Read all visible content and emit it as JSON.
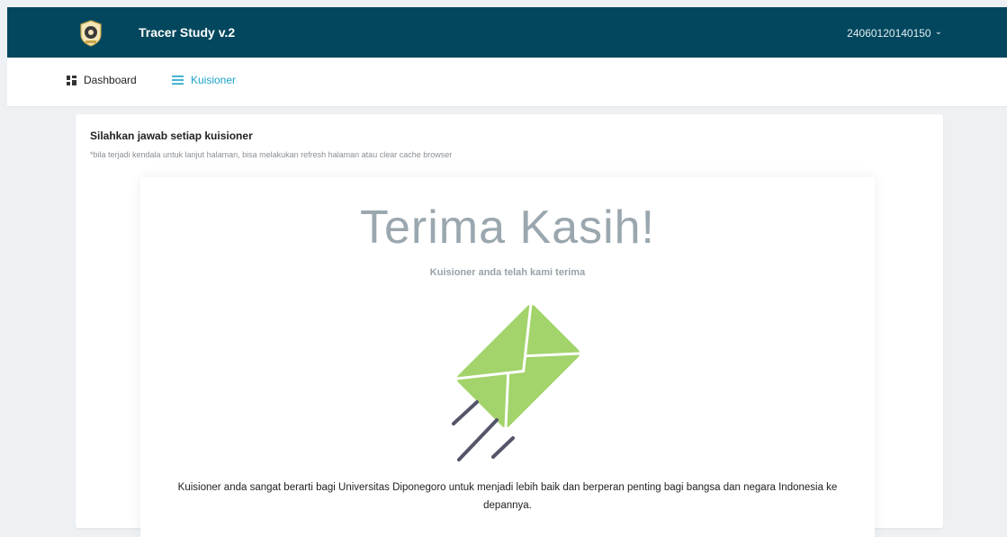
{
  "header": {
    "app_title": "Tracer Study v.2",
    "user_id": "24060120140150",
    "user_chevron": "⌄"
  },
  "nav": {
    "dashboard_label": "Dashboard",
    "kuisioner_label": "Kuisioner"
  },
  "card": {
    "title": "Silahkan jawab setiap kuisioner",
    "note": "*bila terjadi kendala untuk lanjut halaman, bisa melakukan refresh halaman atau clear cache browser"
  },
  "result": {
    "heading": "Terima Kasih!",
    "subheading": "Kuisioner anda telah kami terima",
    "message": "Kuisioner anda sangat berarti bagi Universitas Diponegoro untuk menjadi lebih baik dan berperan penting bagi bangsa dan negara Indonesia ke depannya."
  },
  "icons": {
    "logo": "university-seal-icon",
    "dashboard": "grid-icon",
    "kuisioner": "menu-lines-icon",
    "envelope": "flying-envelope-icon"
  },
  "colors": {
    "header_bg": "#02475e",
    "accent": "#1aa3c8",
    "envelope": "#a3d36b"
  }
}
